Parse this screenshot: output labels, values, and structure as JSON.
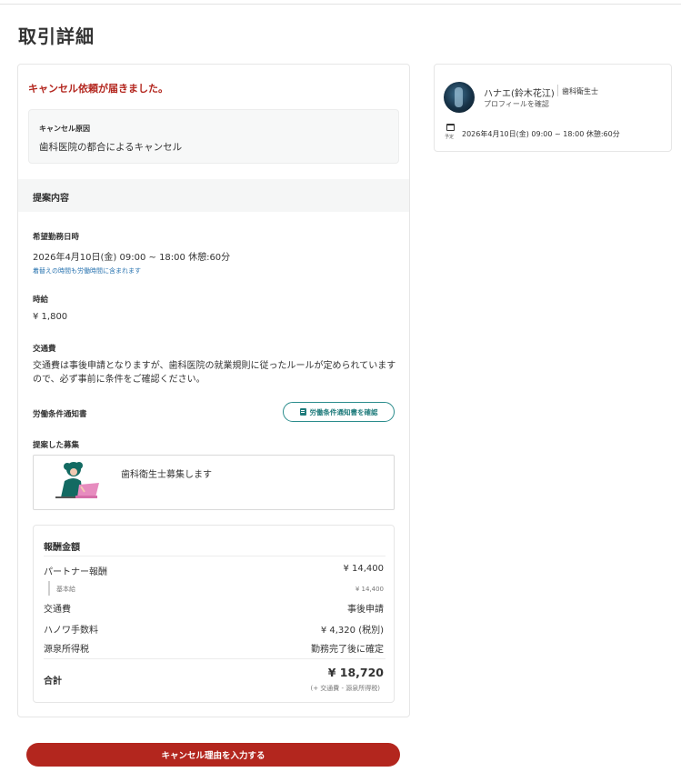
{
  "page": {
    "title": "取引詳細"
  },
  "notice": "キャンセル依頼が届きました。",
  "cancel_reason": {
    "label": "キャンセル原因",
    "text": "歯科医院の都合によるキャンセル"
  },
  "proposal": {
    "heading": "提案内容",
    "work_date_label": "希望勤務日時",
    "work_date_value": "2026年4月10日(金)  09:00 ~ 18:00 休憩:60分",
    "work_date_note": "着替えの時間も労働時間に含まれます",
    "hourly_label": "時給",
    "hourly_value": "¥ 1,800",
    "transport_label": "交通費",
    "transport_text": "交通費は事後申請となりますが、歯科医院の就業規則に従ったルールが定められていますので、必ず事前に条件をご確認ください。",
    "labor_notice_label": "労働条件通知書",
    "labor_notice_button": "労働条件通知書を確認",
    "job_label": "提案した募集",
    "job_title": "歯科衛生士募集します"
  },
  "payment": {
    "title": "報酬金額",
    "rows": [
      {
        "label": "パートナー報酬",
        "value": "¥ 14,400"
      },
      {
        "label": "基本給",
        "value": "¥ 14,400"
      },
      {
        "label": "交通費",
        "value": "事後申請"
      },
      {
        "label": "ハノワ手数料",
        "value": "¥ 4,320 (税別)"
      },
      {
        "label": "源泉所得税",
        "value": "勤務完了後に確定"
      }
    ],
    "total_label": "合計",
    "total_value": "¥ 18,720",
    "total_note": "(+ 交通費 - 源泉所得税)"
  },
  "cancel_button": "キャンセル理由を入力する",
  "partner": {
    "name": "ハナエ(鈴木花江)",
    "role": "歯科衛生士",
    "profile_link": "プロフィールを確認",
    "calendar_caption": "予定",
    "date": "2026年4月10日(金)  09:00 ~ 18:00 休憩:60分"
  },
  "colors": {
    "accent_red": "#b3261e",
    "teal": "#1f7b7b",
    "link_blue": "#2a74b0"
  },
  "icons": [
    "document-icon",
    "calendar-icon",
    "avatar-image",
    "job-illustration"
  ]
}
